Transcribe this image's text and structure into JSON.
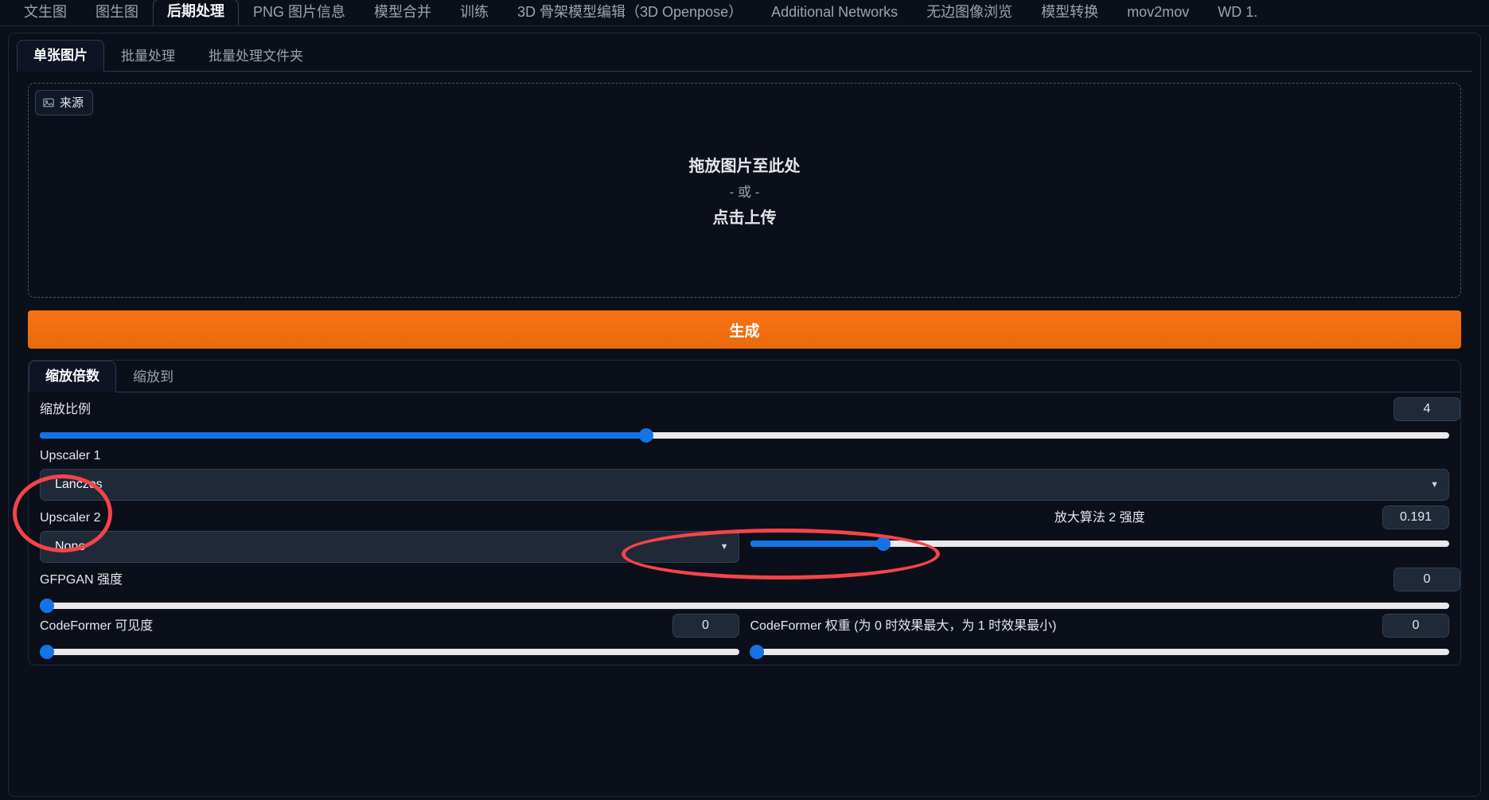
{
  "app": {
    "top_tabs": [
      {
        "label": "文生图",
        "active": false
      },
      {
        "label": "图生图",
        "active": false
      },
      {
        "label": "后期处理",
        "active": true
      },
      {
        "label": "PNG 图片信息",
        "active": false
      },
      {
        "label": "模型合并",
        "active": false
      },
      {
        "label": "训练",
        "active": false
      },
      {
        "label": "3D 骨架模型编辑（3D Openpose）",
        "active": false
      },
      {
        "label": "Additional Networks",
        "active": false
      },
      {
        "label": "无边图像浏览",
        "active": false
      },
      {
        "label": "模型转换",
        "active": false
      },
      {
        "label": "mov2mov",
        "active": false
      },
      {
        "label": "WD 1.",
        "active": false
      }
    ]
  },
  "extras": {
    "sub_tabs": [
      {
        "label": "单张图片",
        "active": true
      },
      {
        "label": "批量处理",
        "active": false
      },
      {
        "label": "批量处理文件夹",
        "active": false
      }
    ],
    "source_badge": {
      "label": "来源",
      "icon": "image-icon"
    },
    "dropzone": {
      "drag_text": "拖放图片至此处",
      "or_text": "- 或 -",
      "upload_text": "点击上传"
    },
    "generate_button": "生成"
  },
  "resize": {
    "tabs": [
      {
        "label": "缩放倍数",
        "active": true
      },
      {
        "label": "缩放到",
        "active": false
      }
    ],
    "scale_label": "缩放比例",
    "scale_value": "4",
    "scale_percent": 43
  },
  "upscaler1": {
    "label": "Upscaler 1",
    "value": "Lanczos"
  },
  "upscaler2": {
    "label": "Upscaler 2",
    "value": "None"
  },
  "upscaler2_strength": {
    "label": "放大算法 2 强度",
    "value": "0.191",
    "percent": 19.1
  },
  "gfpgan": {
    "label": "GFPGAN 强度",
    "value": "0",
    "percent": 0
  },
  "codeformer_visibility": {
    "label": "CodeFormer 可见度",
    "value": "0",
    "percent": 0
  },
  "codeformer_weight": {
    "label": "CodeFormer 权重 (为 0 时效果最大，为 1 时效果最小)",
    "value": "0",
    "percent": 0
  },
  "annotations": {
    "accent_red": "#f4444a",
    "accent_orange": "#f97316",
    "accent_blue": "#1473e6"
  }
}
